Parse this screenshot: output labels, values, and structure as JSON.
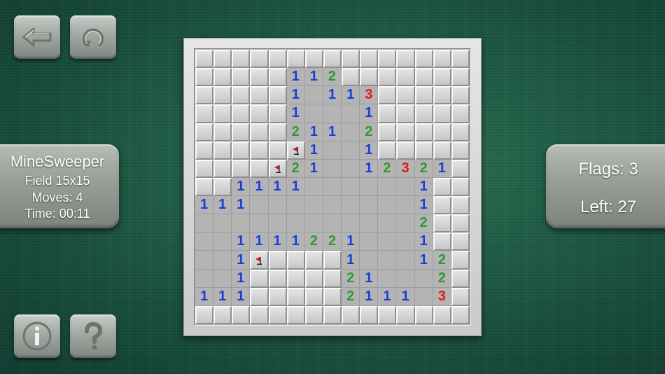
{
  "game": {
    "name": "MineSweeper",
    "field": "Field 15x15",
    "moves": "Moves: 4",
    "time": "Time: 00:11"
  },
  "stats": {
    "flags": "Flags: 3",
    "left": "Left: 27"
  },
  "icons": {
    "back": "back-arrow-icon",
    "restart": "restart-icon",
    "info": "info-icon",
    "help": "help-icon",
    "flag": "flag-icon"
  },
  "colors": {
    "one": "#1a3fd6",
    "two": "#2a9a33",
    "three": "#e8161b"
  },
  "board": {
    "size": 15,
    "rows": [
      "###############",
      "#####112#######",
      "#####1 113#####",
      "#####1   1#####",
      "#####211 2#####",
      "#####F1  1#####",
      "####F21  12321#",
      "##1111      1##",
      "111         1##",
      "            2##",
      "  1111221   1##",
      "  1F####1   12#",
      "  1#####21   2#",
      "111#####2111 3#",
      "###############"
    ]
  }
}
